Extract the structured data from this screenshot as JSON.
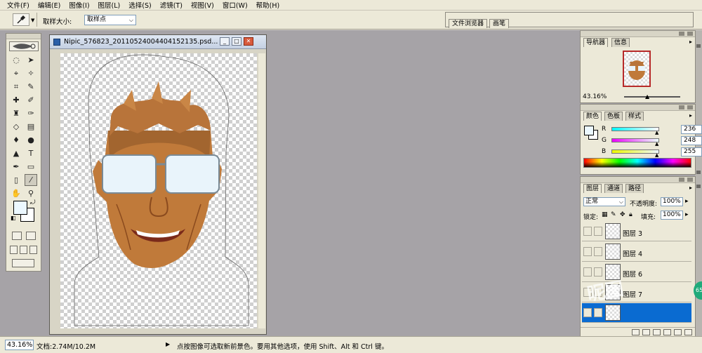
{
  "menu": [
    "文件(F)",
    "编辑(E)",
    "图像(I)",
    "图层(L)",
    "选择(S)",
    "滤镜(T)",
    "视图(V)",
    "窗口(W)",
    "帮助(H)"
  ],
  "options": {
    "sample_size_label": "取样大小:",
    "sample_size_value": "取样点",
    "well_tabs": [
      "文件浏览器",
      "画笔"
    ]
  },
  "document": {
    "title": "Nipic_576823_20110524004404152135.psd..."
  },
  "status": {
    "zoom": "43.16%",
    "doc_info": "文档:2.74M/10.2M",
    "hint": "点按图像可选取新前景色。要用其他选项，使用 Shift、Alt 和 Ctrl 键。"
  },
  "navigator": {
    "tabs": [
      "导航器",
      "信息"
    ],
    "zoom": "43.16%"
  },
  "color": {
    "tabs": [
      "颜色",
      "色板",
      "样式"
    ],
    "channels": [
      {
        "label": "R",
        "value": "236",
        "gradient": "linear-gradient(to right,#00f8ff,#fff8ff)"
      },
      {
        "label": "G",
        "value": "248",
        "gradient": "linear-gradient(to right,#ec00ff,#ecffff)"
      },
      {
        "label": "B",
        "value": "255",
        "gradient": "linear-gradient(to right,#ecf800,#ecf8ff)"
      }
    ],
    "foreground": "#ecf8ff"
  },
  "layers": {
    "tabs": [
      "图层",
      "通道",
      "路径"
    ],
    "blend_mode": "正常",
    "opacity_label": "不透明度:",
    "opacity_value": "100%",
    "lock_label": "锁定:",
    "fill_label": "填充:",
    "fill_value": "100%",
    "items": [
      {
        "name": "图层 3",
        "selected": false
      },
      {
        "name": "图层 4",
        "selected": false
      },
      {
        "name": "图层 6",
        "selected": false
      },
      {
        "name": "图层 7",
        "selected": false
      },
      {
        "name": "",
        "selected": true
      }
    ]
  },
  "watermark": "昵图",
  "badge": "65"
}
